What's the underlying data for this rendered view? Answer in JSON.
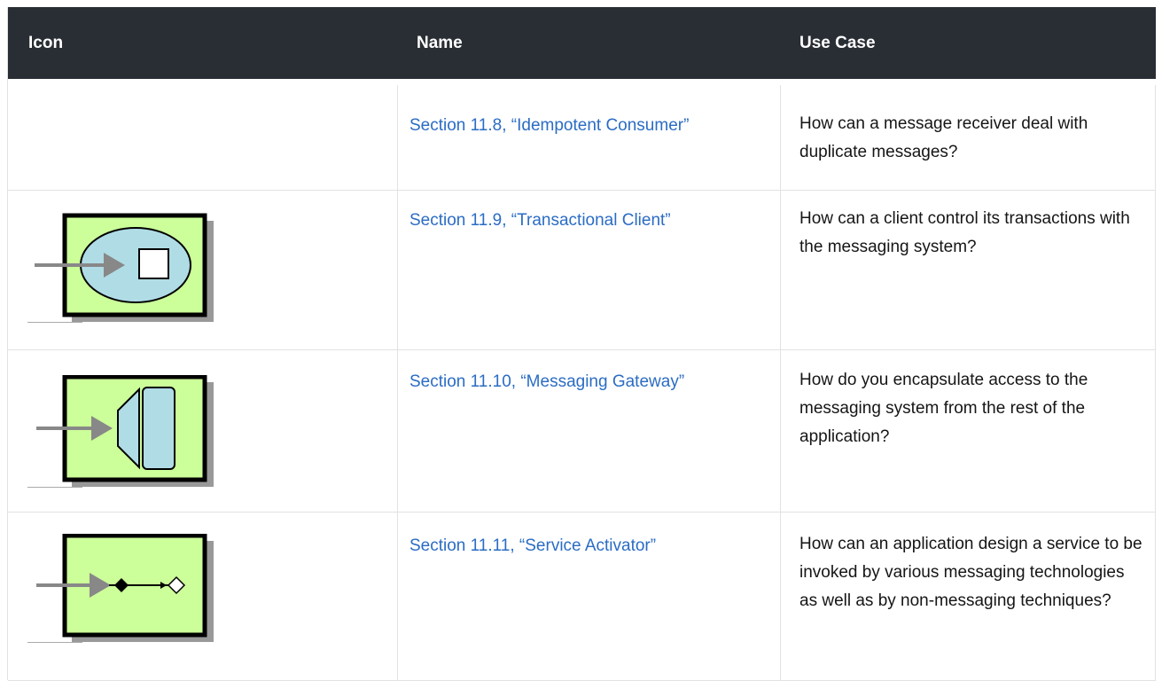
{
  "header": {
    "col_icon": "Icon",
    "col_name": "Name",
    "col_use_case": "Use Case"
  },
  "rows": [
    {
      "icon": "none",
      "name": "Section 11.8, “Idempotent Consumer”",
      "use_case": "How can a message receiver deal with duplicate messages?"
    },
    {
      "icon": "transactional-client-icon",
      "name": "Section 11.9, “Transactional Client”",
      "use_case": "How can a client control its transactions with the messaging system?"
    },
    {
      "icon": "messaging-gateway-icon",
      "name": "Section 11.10, “Messaging Gateway”",
      "use_case": "How do you encapsulate access to the messaging system from the rest of the application?"
    },
    {
      "icon": "service-activator-icon",
      "name": "Section 11.11, “Service Activator”",
      "use_case": "How can an application design a service to be invoked by various messaging technologies as well as by non-messaging techniques?"
    }
  ],
  "colors": {
    "header_bg": "#292e34",
    "header_text": "#ffffff",
    "link": "#2b6cc4",
    "icon_fill": "#ccff99",
    "shape_fill": "#b0dce6",
    "arrow": "#888888"
  }
}
